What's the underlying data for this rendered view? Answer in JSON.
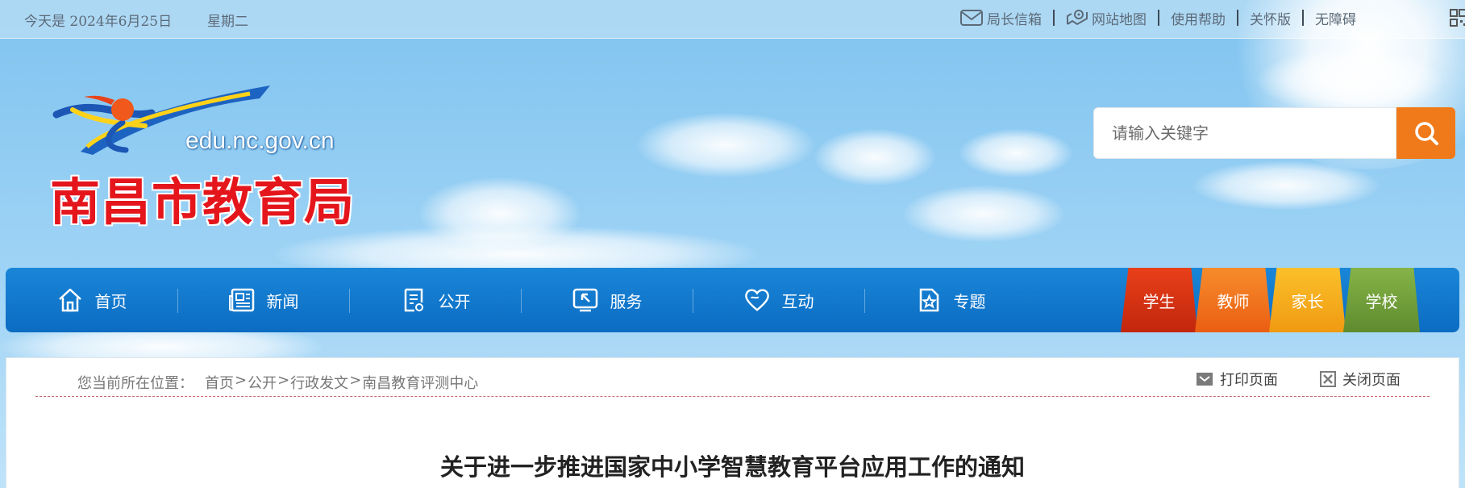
{
  "topbar": {
    "date": "今天是 2024年6月25日",
    "weekday": "星期二",
    "links": [
      {
        "label": "局长信箱",
        "icon": "mail-icon"
      },
      {
        "label": "网站地图",
        "icon": "map-icon"
      },
      {
        "label": "使用帮助"
      },
      {
        "label": "关怀版"
      },
      {
        "label": "无障碍"
      }
    ]
  },
  "logo": {
    "domain": "edu.nc.gov.cn",
    "name": "南昌市教育局"
  },
  "search": {
    "placeholder": "请输入关键字",
    "icon": "search-icon"
  },
  "nav": {
    "items": [
      {
        "label": "首页",
        "icon": "home-icon"
      },
      {
        "label": "新闻",
        "icon": "newspaper-icon"
      },
      {
        "label": "公开",
        "icon": "document-icon"
      },
      {
        "label": "服务",
        "icon": "service-icon"
      },
      {
        "label": "互动",
        "icon": "heart-icon"
      },
      {
        "label": "专题",
        "icon": "star-document-icon"
      }
    ],
    "roles": [
      {
        "label": "学生",
        "color": "#d2300f"
      },
      {
        "label": "教师",
        "color": "#f0661a"
      },
      {
        "label": "家长",
        "color": "#f3a81a"
      },
      {
        "label": "学校",
        "color": "#6f9b3a"
      }
    ]
  },
  "breadcrumb": {
    "prefix": "您当前所在位置：",
    "path": [
      "首页",
      "公开",
      "行政发文",
      "南昌教育评测中心"
    ],
    "separator": ">"
  },
  "tools": {
    "print": "打印页面",
    "close": "关闭页面"
  },
  "article": {
    "title": "关于进一步推进国家中小学智慧教育平台应用工作的通知"
  },
  "colors": {
    "nav_blue": "#0b6cc2",
    "search_orange": "#f07a1a",
    "logo_red": "#e4161c"
  }
}
